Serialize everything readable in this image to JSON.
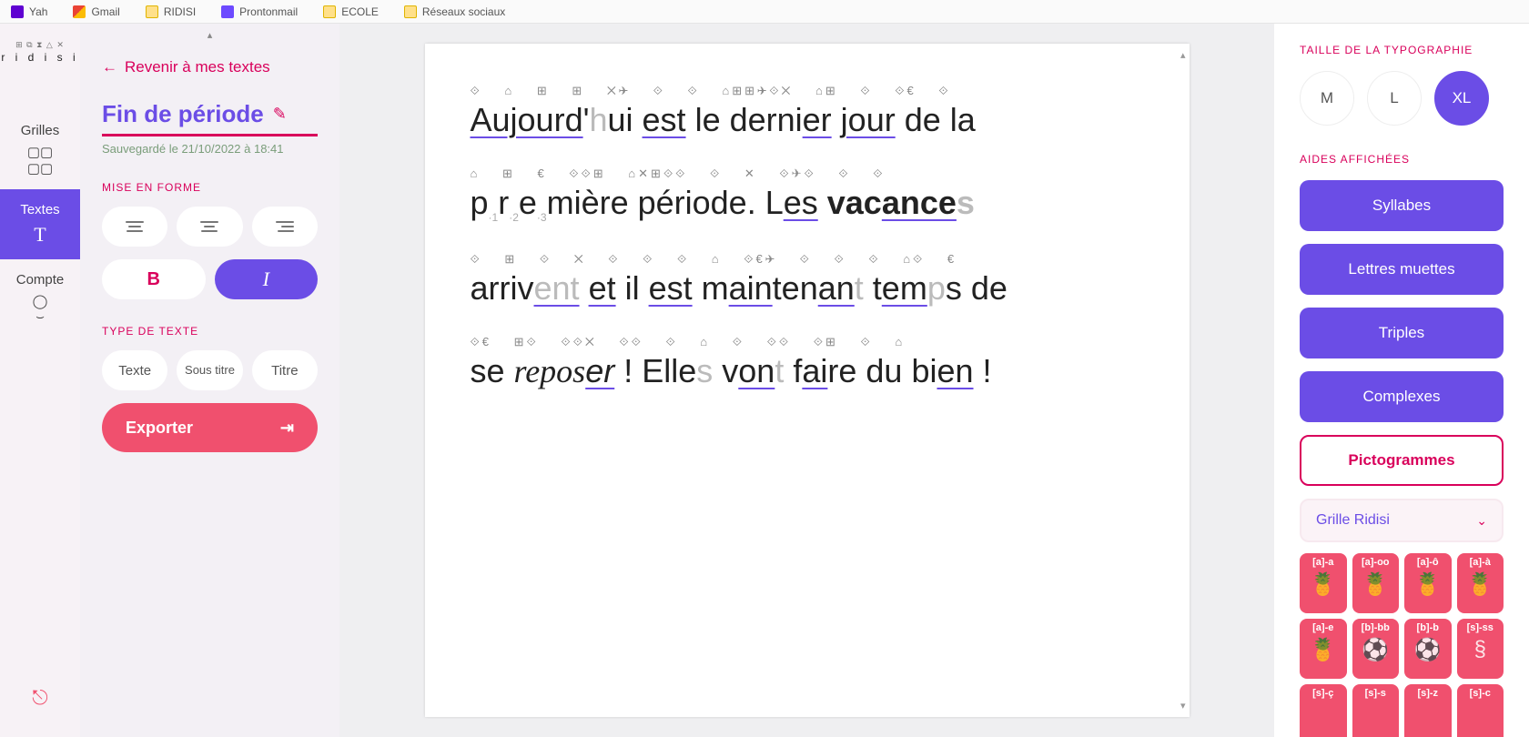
{
  "bookmarks": [
    {
      "label": "Yah",
      "icon": "yah"
    },
    {
      "label": "Gmail",
      "icon": "gmail"
    },
    {
      "label": "RIDISI",
      "icon": "folder"
    },
    {
      "label": "Prontonmail",
      "icon": "proton"
    },
    {
      "label": "ECOLE",
      "icon": "folder"
    },
    {
      "label": "Réseaux sociaux",
      "icon": "folder"
    }
  ],
  "brand": "r i d i s i",
  "rail": {
    "grilles": "Grilles",
    "textes": "Textes",
    "compte": "Compte"
  },
  "left": {
    "back": "Revenir à mes textes",
    "title": "Fin de période",
    "saved": "Sauvegardé le 21/10/2022 à 18:41",
    "mise_en_forme": "MISE EN FORME",
    "bold": "B",
    "italic": "I",
    "type_de_texte": "TYPE DE TEXTE",
    "texte": "Texte",
    "sous_titre": "Sous titre",
    "titre": "Titre",
    "exporter": "Exporter"
  },
  "doc": {
    "lines": [
      {
        "pictos": "⟐ ⌂ ⊞ ⊞    ✕✈ ⟐  ⟐  ⌂⊞⊞✈⟐✕  ⌂⊞ ⟐ ⟐€ ⟐",
        "html": "<span class='u'>Aujourd</span>'<span class='mute'>h</span>ui <span class='u'>est</span> le derni<span class='u'>er</span> <span class='u'>jour</span> de la"
      },
      {
        "pictos": "⌂ ⊞ €  ⟐⟐⊞   ⌂✕⊞⟐⟐   ⟐ ✕  ⟐✈⟐ ⟐ ⟐",
        "html": "p<sub style='font-size:12px;color:#aaa'>·1</sub>r<sub style='font-size:12px;color:#aaa'>·2</sub>e<sub style='font-size:12px;color:#aaa'>·3</sub>mière période. L<span class='u'>es</span> <strong>vac<span class='u'>ance</span><span class='mute'>s</span></strong>"
      },
      {
        "pictos": "⟐ ⊞ ⟐   ✕  ⟐ ⟐  ⟐  ⌂ ⟐€✈ ⟐ ⟐ ⟐   ⌂⟐ €",
        "html": "arriv<span class='u mute'>ent</span> <span class='u'>et</span> il <span class='u'>est</span> m<span class='u'>ain</span>ten<span class='u'>an</span><span class='mute'>t</span> t<span class='u'>em</span><span class='mute'>p</span>s de"
      },
      {
        "pictos": "⟐€ ⊞⟐ ⟐⟐✕   ⟐⟐ ⟐ ⌂  ⟐ ⟐⟐ ⟐⊞ ⟐ ⌂",
        "html": "se <em>repos<span class='u'>er</span></em> ! Elle<span class='mute'>s</span> v<span class='u'>on</span><span class='mute'>t</span> f<span class='u'>ai</span>re du bi<span class='u'>en</span> !"
      }
    ]
  },
  "right": {
    "taille": "TAILLE DE LA TYPOGRAPHIE",
    "sizes": {
      "m": "M",
      "l": "L",
      "xl": "XL"
    },
    "aides": "AIDES AFFICHÉES",
    "aid_syllabes": "Syllabes",
    "aid_muettes": "Lettres muettes",
    "aid_triples": "Triples",
    "aid_complexes": "Complexes",
    "pictogrammes": "Pictogrammes",
    "grille": "Grille Ridisi",
    "cells": [
      {
        "code": "[a]-a",
        "glyph": "🍍"
      },
      {
        "code": "[a]-oo",
        "glyph": "🍍"
      },
      {
        "code": "[a]-ô",
        "glyph": "🍍"
      },
      {
        "code": "[a]-à",
        "glyph": "🍍"
      },
      {
        "code": "[a]-e",
        "glyph": "🍍"
      },
      {
        "code": "[b]-bb",
        "glyph": "⚽"
      },
      {
        "code": "[b]-b",
        "glyph": "⚽"
      },
      {
        "code": "[s]-ss",
        "glyph": "§"
      },
      {
        "code": "[s]-ç",
        "glyph": ""
      },
      {
        "code": "[s]-s",
        "glyph": ""
      },
      {
        "code": "[s]-z",
        "glyph": ""
      },
      {
        "code": "[s]-c",
        "glyph": ""
      }
    ]
  }
}
